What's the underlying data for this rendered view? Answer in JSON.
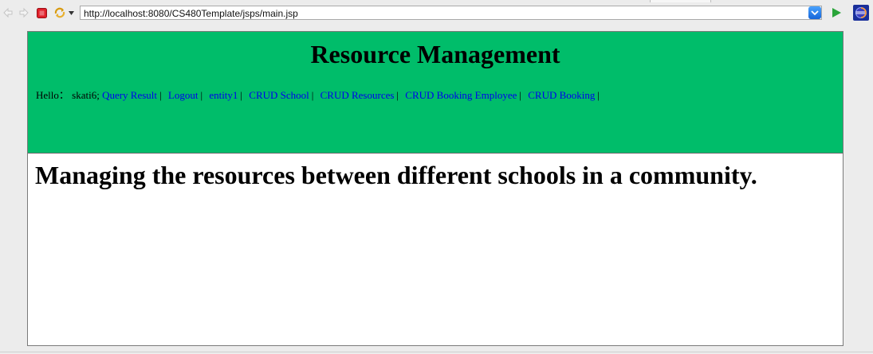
{
  "browser": {
    "url": "http://localhost:8080/CS480Template/jsps/main.jsp",
    "icons": {
      "back": "back-arrow-icon",
      "forward": "forward-arrow-icon",
      "stop": "stop-icon",
      "refresh": "refresh-icon",
      "url_dropdown": "chevron-down-icon",
      "go": "play-icon",
      "app": "eclipse-icon"
    },
    "colors": {
      "stop": "#e0202a",
      "go": "#2aa43a",
      "url_dropdown": "#2f7fe8"
    }
  },
  "page": {
    "title": "Resource Management",
    "greeting_label": "Hello：",
    "username": "skati6;",
    "separator": "|",
    "links": [
      "Query Result",
      "Logout",
      "entity1",
      "CRUD School",
      "CRUD Resources",
      "CRUD Booking Employee",
      "CRUD Booking"
    ],
    "tagline": "Managing the resources between different schools in a community.",
    "colors": {
      "header_bg": "#00bd6a",
      "link": "#0000ee"
    }
  }
}
